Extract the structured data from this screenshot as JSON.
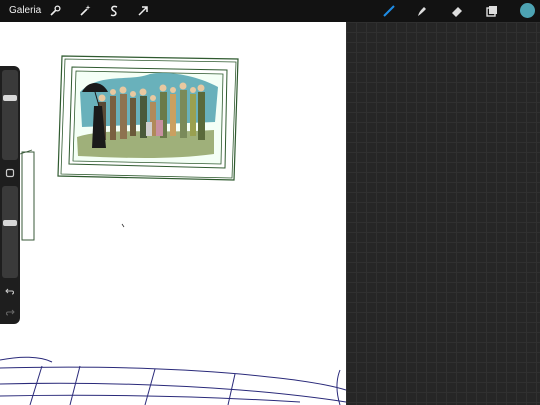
{
  "topbar": {
    "gallery_label": "Galeria",
    "left_tools": [
      "wrench-icon",
      "magic-wand-icon",
      "selection-icon",
      "transform-arrow-icon"
    ],
    "right_tools": [
      "brush-icon",
      "smudge-icon",
      "eraser-icon",
      "layers-icon",
      "color-swatch"
    ]
  },
  "colors": {
    "active_tool": "#1e8ce6",
    "current_color": "#4da3b3",
    "panel": "#262626",
    "canvas": "#ffffff"
  },
  "sidebar": {
    "brush_size_level": 0.7,
    "opacity_level": 0.6,
    "buttons": [
      "square-modify-icon",
      "undo-icon",
      "redo-icon"
    ]
  }
}
